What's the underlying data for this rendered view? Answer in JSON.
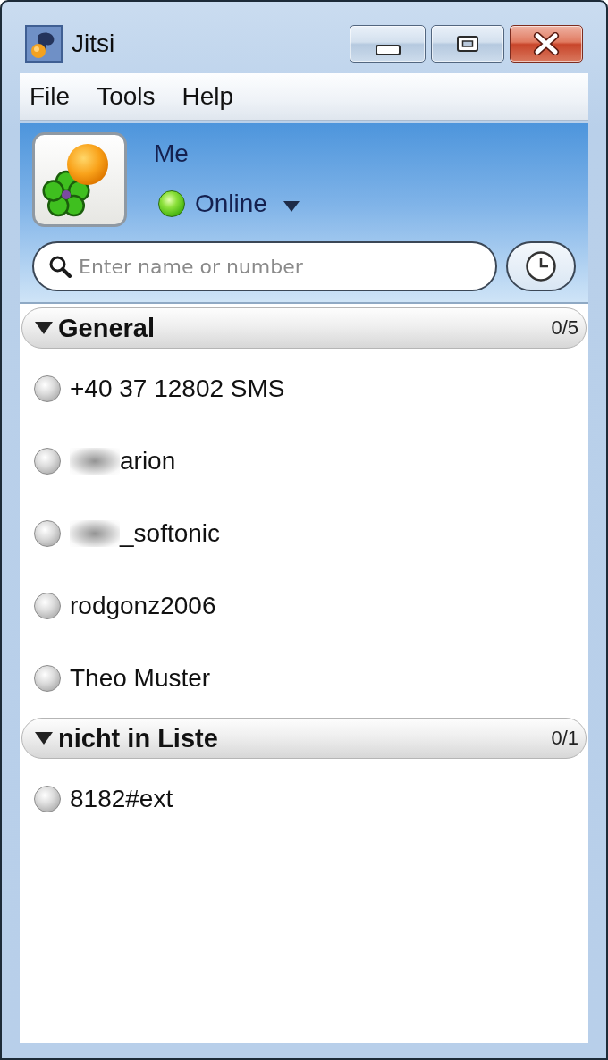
{
  "window": {
    "title": "Jitsi"
  },
  "menu": [
    "File",
    "Tools",
    "Help"
  ],
  "account": {
    "name": "Me",
    "status": "Online",
    "online": true
  },
  "search": {
    "placeholder": "Enter name or number"
  },
  "groups": [
    {
      "name": "General",
      "count": "0/5",
      "expanded": true,
      "contacts": [
        {
          "name": "+40 37 12802 SMS",
          "online": false,
          "redacted": false
        },
        {
          "name": "arion",
          "online": false,
          "redacted": true
        },
        {
          "name": "_softonic",
          "online": false,
          "redacted": true
        },
        {
          "name": "rodgonz2006",
          "online": false,
          "redacted": false
        },
        {
          "name": "Theo Muster",
          "online": false,
          "redacted": false
        }
      ]
    },
    {
      "name": "nicht in Liste",
      "count": "0/1",
      "expanded": true,
      "contacts": [
        {
          "name": "8182#ext",
          "online": false,
          "redacted": false
        }
      ]
    }
  ]
}
